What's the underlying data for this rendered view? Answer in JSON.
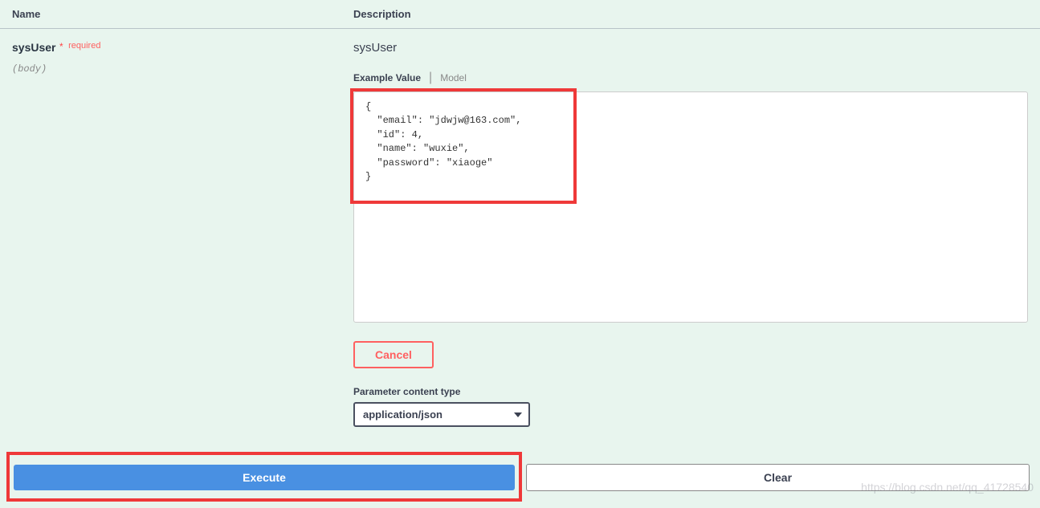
{
  "headers": {
    "name": "Name",
    "description": "Description"
  },
  "param": {
    "name": "sysUser",
    "required_star": "*",
    "required_text": "required",
    "body_label": "(body)",
    "type": "sysUser"
  },
  "tabs": {
    "example_value": "Example Value",
    "model": "Model"
  },
  "code_value": "{\n  \"email\": \"jdwjw@163.com\",\n  \"id\": 4,\n  \"name\": \"wuxie\",\n  \"password\": \"xiaoge\"\n}",
  "buttons": {
    "cancel": "Cancel",
    "execute": "Execute",
    "clear": "Clear"
  },
  "content_type": {
    "label": "Parameter content type",
    "value": "application/json"
  },
  "watermark": "https://blog.csdn.net/qq_41728540"
}
